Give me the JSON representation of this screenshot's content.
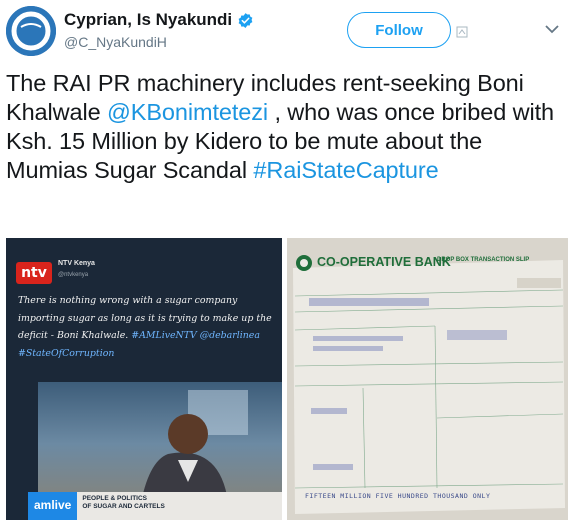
{
  "author": {
    "display_name": "Cyprian, Is Nyakundi",
    "handle": "@C_NyaKundiH",
    "verified": true
  },
  "actions": {
    "follow_label": "Follow"
  },
  "tweet": {
    "seg1": "The RAI PR machinery includes rent-seeking Boni Khalwale ",
    "mention": "@KBonimtetezi",
    "seg2": " , who was once bribed with Ksh. 15 Million by Kidero  to be mute about the Mumias Sugar Scandal ",
    "hashtag": "#RaiStateCapture"
  },
  "media": {
    "left": {
      "channel_name": "NTV Kenya",
      "channel_handle": "@ntvkenya",
      "quote": "There is nothing wrong with a sugar company importing sugar as long as it is trying to make up the deficit - Boni Khalwale. ",
      "quote_tags": "#AMLiveNTV @debarlinea #StateOfCorruption",
      "logo_text": "ntv",
      "show_label": "amlive",
      "show_title": "PEOPLE & POLITICS",
      "show_subtitle": "OF SUGAR AND CARTELS"
    },
    "right": {
      "bank_name": "CO-OPERATIVE BANK",
      "slip_title": "DROP BOX TRANSACTION SLIP",
      "amount_words": "FIFTEEN MILLION FIVE HUNDRED THOUSAND ONLY"
    }
  },
  "colors": {
    "link": "#1b95e0",
    "follow": "#1da1f2",
    "verified": "#1da1f2"
  }
}
